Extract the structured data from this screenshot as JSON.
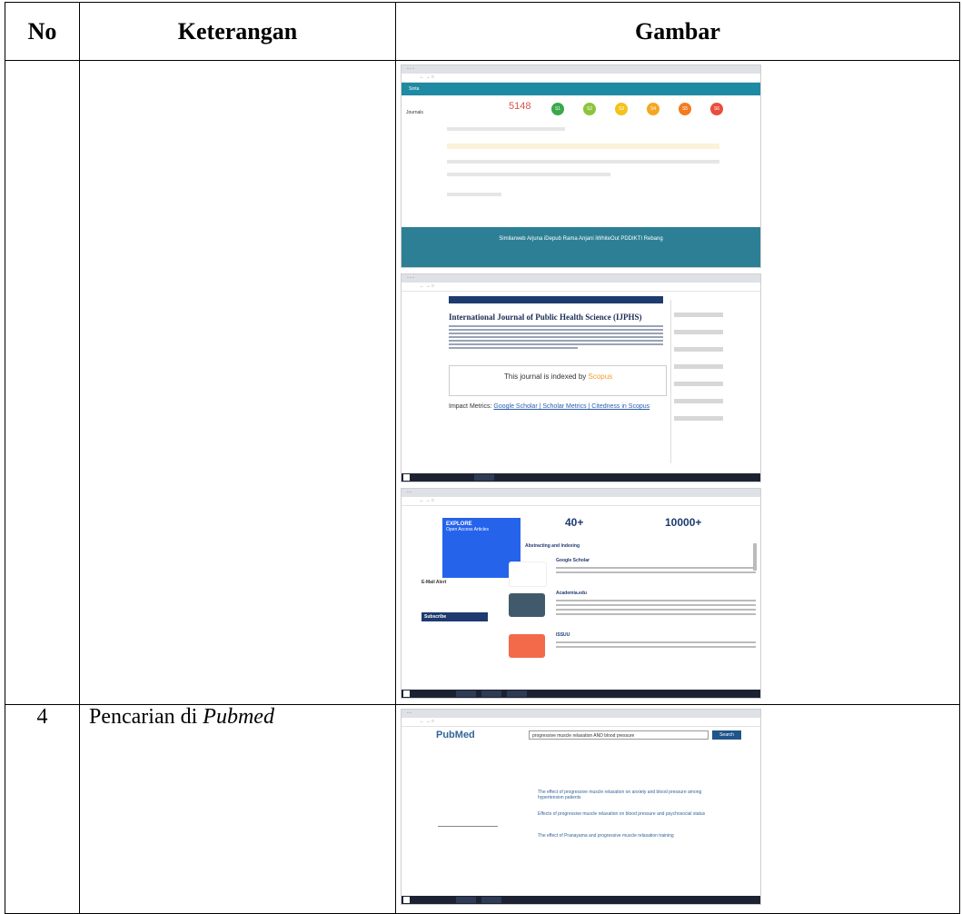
{
  "table": {
    "headers": {
      "no": "No",
      "keterangan": "Keterangan",
      "gambar": "Gambar"
    },
    "rows": [
      {
        "no": "",
        "keterangan": ""
      },
      {
        "no": "4",
        "keterangan_prefix": "Pencarian di ",
        "keterangan_em": "Pubmed"
      }
    ]
  },
  "shot1": {
    "brand": "Sinta",
    "label": "Journals",
    "count": "5148",
    "circles": [
      "S1",
      "S2",
      "S3",
      "S4",
      "S5",
      "S6"
    ],
    "footer": "Similarweb   Arjuna   iDepub   Rama   Anjani   iWhiteOut   PDDIKTI   Rebang"
  },
  "shot2": {
    "title": "International Journal of Public Health Science (IJPHS)",
    "banner_pre": "This journal is indexed by ",
    "banner_brand": "Scopus",
    "impact_pre": "Impact Metrics: ",
    "impact_links": "Google Scholar | Scholar Metrics | Citedness in Scopus"
  },
  "shot3": {
    "explore": "EXPLORE",
    "explore_sub": "Open Access Articles",
    "stat1": "40+",
    "stat2": "10000+",
    "abstracting": "Abstracting and Indexing",
    "gs": "Google Scholar",
    "acad": "Academia.edu",
    "issuu": "ISSUU",
    "email_alert": "E-Mail Alert",
    "subscribe": "Subscribe"
  },
  "shot4": {
    "logo": "PubMed",
    "query": "progressive muscle relaxation AND blood pressure",
    "search": "Search",
    "results": [
      "The effect of progressive muscle relaxation on anxiety and blood pressure among hypertension patients",
      "Effects of progressive muscle relaxation on blood pressure and psychosocial status",
      "The effect of Pranayama and progressive muscle relaxation training"
    ]
  }
}
